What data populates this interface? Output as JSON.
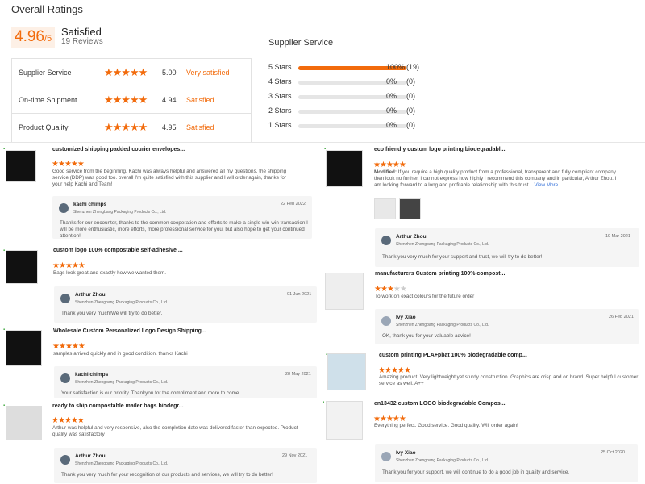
{
  "header": {
    "title": "Overall Ratings"
  },
  "overall": {
    "score": "4.96",
    "score_suffix": "/5",
    "label": "Satisfied",
    "reviews": "19 Reviews"
  },
  "ratings": [
    {
      "label": "Supplier Service",
      "score": "5.00",
      "word": "Very satisfied"
    },
    {
      "label": "On-time Shipment",
      "score": "4.94",
      "word": "Satisfied"
    },
    {
      "label": "Product Quality",
      "score": "4.95",
      "word": "Satisfied"
    }
  ],
  "supplier_service": {
    "title": "Supplier Service",
    "bars": [
      {
        "label": "5 Stars",
        "percent": "100%",
        "count": "(19)",
        "fill": 1.0
      },
      {
        "label": "4 Stars",
        "percent": "0%",
        "count": "(0)",
        "fill": 0
      },
      {
        "label": "3 Stars",
        "percent": "0%",
        "count": "(0)",
        "fill": 0
      },
      {
        "label": "2 Stars",
        "percent": "0%",
        "count": "(0)",
        "fill": 0
      },
      {
        "label": "1 Stars",
        "percent": "0%",
        "count": "(0)",
        "fill": 0
      }
    ]
  },
  "colors": {
    "accent": "#f26b0c",
    "star_off": "#cccccc"
  },
  "reviews": [
    {
      "title": "customized shipping padded courier envelopes...",
      "stars": 5,
      "text": "Good service from the beginning. Kachi was always helpful and answered all my questions, the shipping service (DDP) was good too. overall I'm quite satisfied with this supplier and I will order again, thanks for your help Kachi and Team!",
      "reply": {
        "name": "kachi chimps",
        "company": "Shenzhen Zhengbang Packaging Products Co., Ltd.",
        "date": "22 Feb 2022",
        "text": "Thanks for our encounter, thanks to the common cooperation and efforts to make a single win-win transaction!I will be more enthusiastic, more efforts, more professional service for you, but also hope to get your continued attention!"
      }
    },
    {
      "title": "custom logo 100% compostable self-adhesive ...",
      "stars": 5,
      "text": "Bags look great and exactly how we wanted them.",
      "reply": {
        "name": "Arthur Zhou",
        "company": "Shenzhen Zhengbang Packaging Products Co., Ltd.",
        "date": "01 Jun 2021",
        "text": "Thank you very much!We will try to do better."
      }
    },
    {
      "title": "Wholesale Custom Personalized Logo Design Shipping...",
      "stars": 5,
      "text": "samples arrived quickly and in good condition. thanks Kachi",
      "reply": {
        "name": "kachi chimps",
        "company": "Shenzhen Zhengbang Packaging Products Co., Ltd.",
        "date": "28 May 2021",
        "text": "Your satisfaction is our priority. Thankyou for the compliment and more to come"
      }
    },
    {
      "title": "ready to ship compostable mailer bags biodegr...",
      "stars": 5,
      "text": "Arthur was helpful and very responsive, also the completion date was delivered faster than expected. Product quality was satisfactory",
      "reply": {
        "name": "Arthur Zhou",
        "company": "Shenzhen Zhengbang Packaging Products Co., Ltd.",
        "date": "29 Nov 2021",
        "text": "Thank you very much for your recognition of our products and services, we will try to do better!"
      }
    },
    {
      "title": "eco friendly custom logo printing biodegradabl...",
      "stars": 5,
      "modified_label": "Modified:",
      "text": "If you require a high quality product from a professional, transparent and fully compliant company then look no further. I cannot express how highly I recommend this company and in particular, Arthur Zhou. I am looking forward to a long and profitable relationship with this trust...",
      "more": "View More",
      "reply": {
        "name": "Arthur Zhou",
        "company": "Shenzhen Zhengbang Packaging Products Co., Ltd.",
        "date": "19 Mar 2021",
        "text": "Thank you very much for your support and trust, we will try to do better!"
      }
    },
    {
      "title": "manufacturers Custom printing 100% compost...",
      "stars": 3,
      "text": "To work on exact colours for the future order",
      "reply": {
        "name": "Ivy Xiao",
        "company": "Shenzhen Zhengbang Packaging Products Co., Ltd.",
        "date": "26 Feb 2021",
        "text": "OK, thank you for your valuable advice!"
      }
    },
    {
      "title": "custom printing PLA+pbat 100% biodegradable comp...",
      "stars": 5,
      "text": "Amazing product. Very lightweight yet sturdy construction. Graphics are crisp and on brand. Super helpful customer service as well. A++"
    },
    {
      "title": "en13432 custom LOGO biodegradable Compos...",
      "stars": 5,
      "text": "Everything perfect. Good service. Good quality. Will order again!",
      "reply": {
        "name": "Ivy Xiao",
        "company": "Shenzhen Zhengbang Packaging Products Co., Ltd.",
        "date": "25 Oct 2020",
        "text": "Thank you for your support, we will continue to do a good job in quality and service."
      }
    }
  ]
}
